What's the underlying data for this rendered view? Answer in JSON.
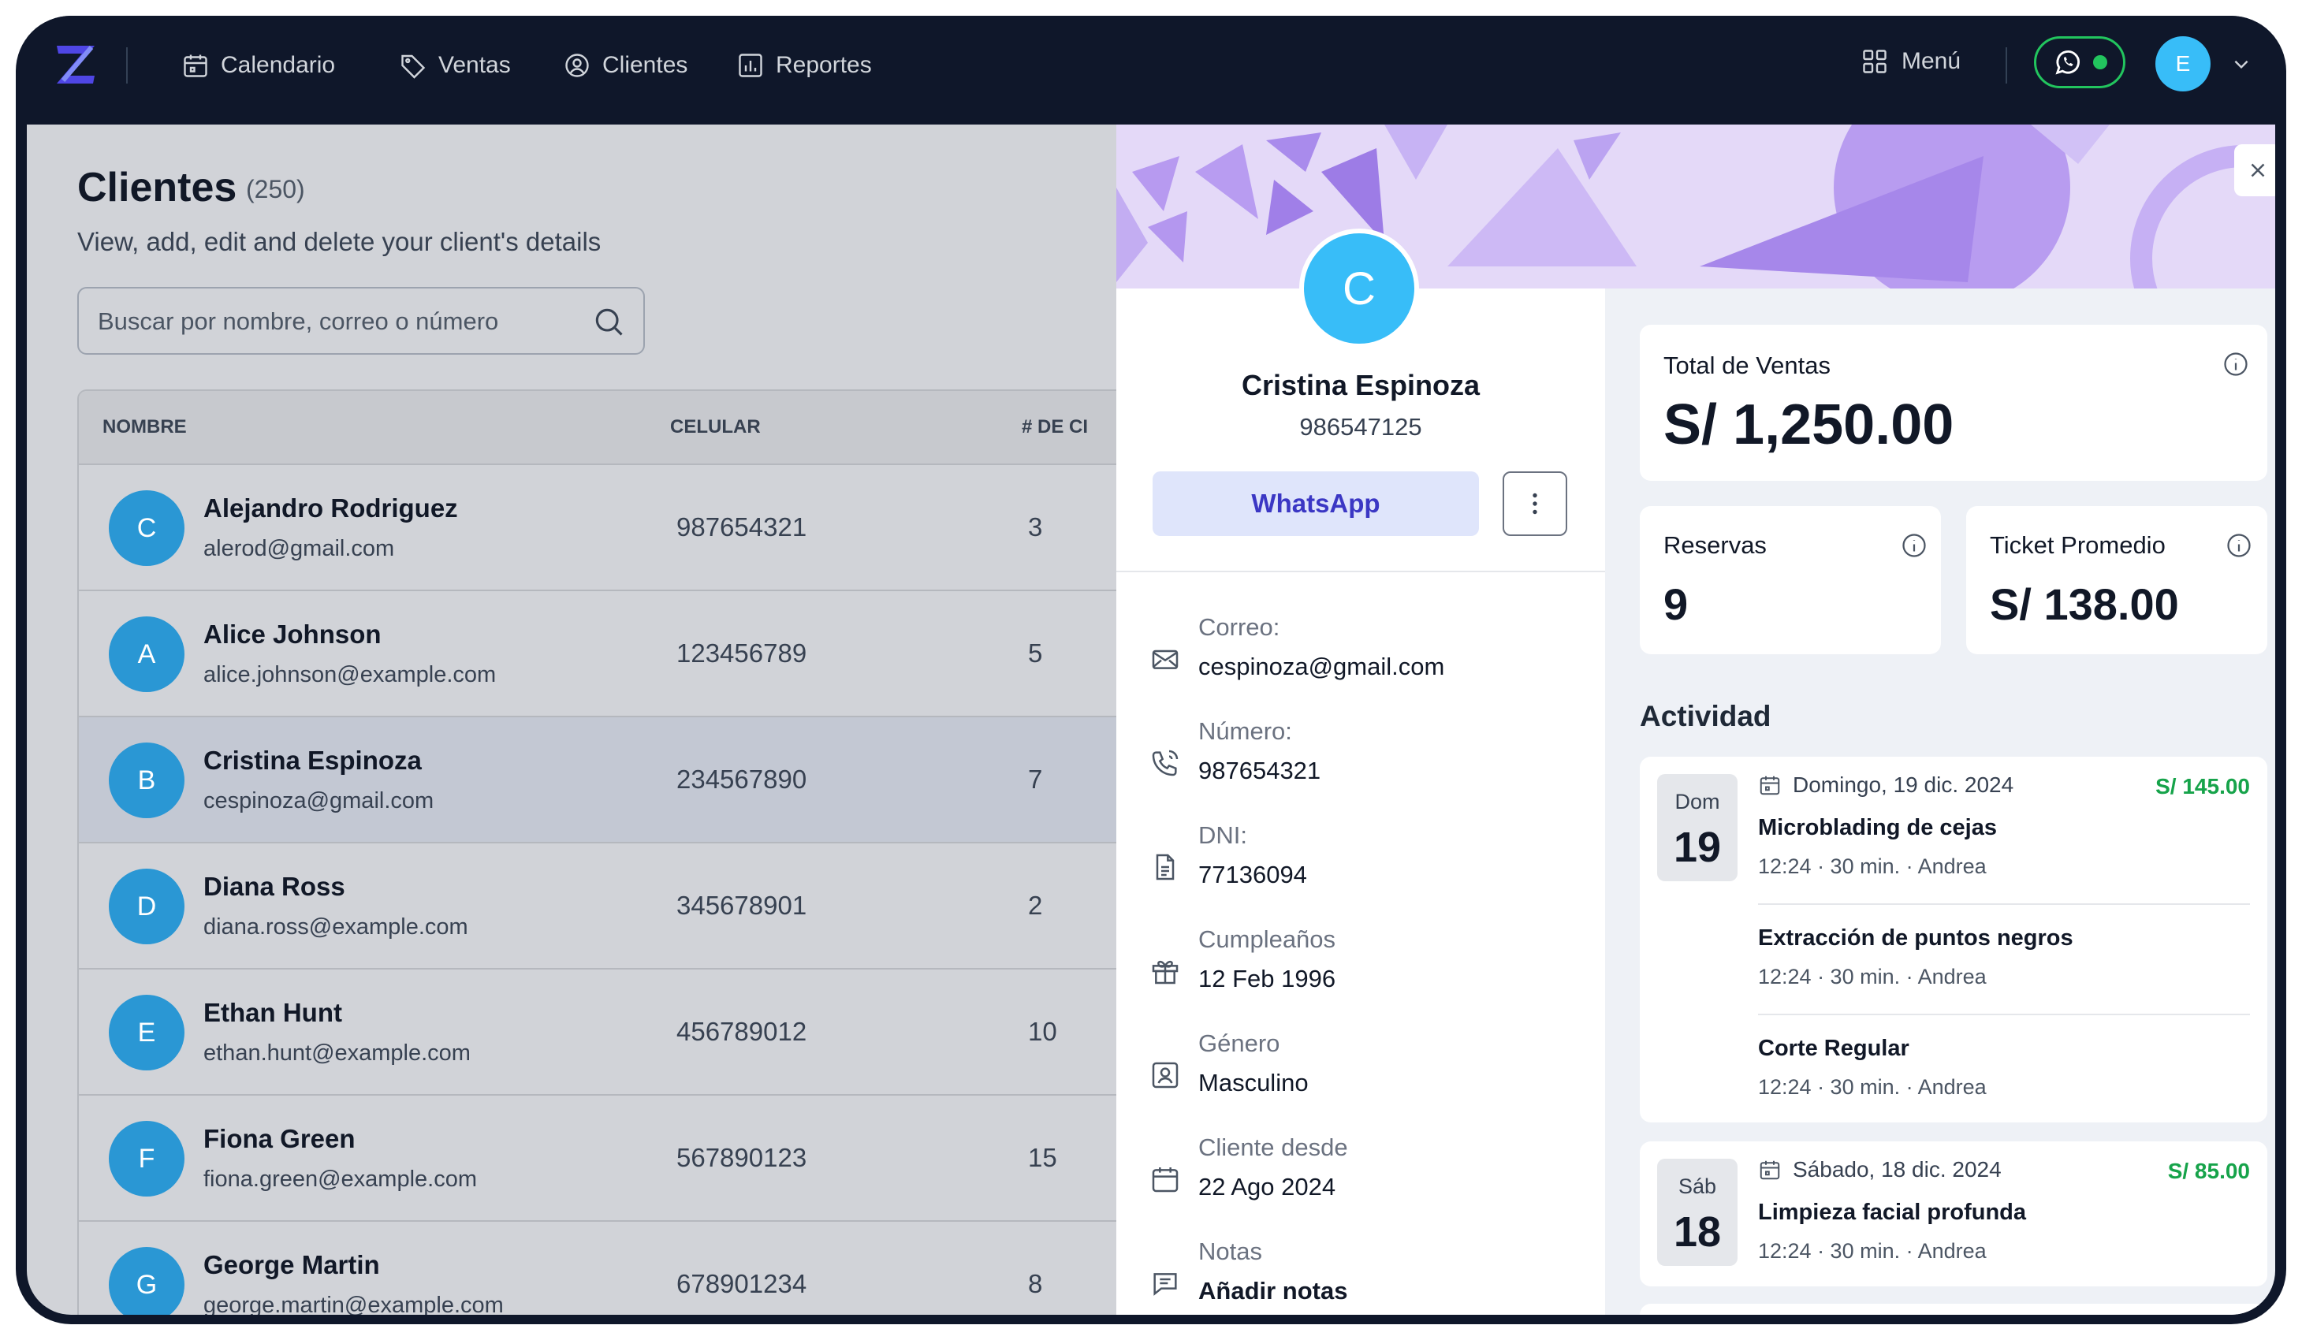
{
  "nav": {
    "items": [
      {
        "label": "Calendario",
        "icon": "calendar-icon"
      },
      {
        "label": "Ventas",
        "icon": "tag-icon"
      },
      {
        "label": "Clientes",
        "icon": "user-circle-icon"
      },
      {
        "label": "Reportes",
        "icon": "bar-chart-icon"
      }
    ],
    "menu_label": "Menú",
    "avatar_initial": "E"
  },
  "clients": {
    "title": "Clientes",
    "count": "(250)",
    "subtitle": "View, add, edit and delete your client's details",
    "search_placeholder": "Buscar por nombre, correo o número",
    "columns": [
      "NOMBRE",
      "CELULAR",
      "# DE CI"
    ],
    "rows": [
      {
        "initial": "C",
        "name": "Alejandro Rodriguez",
        "email": "alerod@gmail.com",
        "phone": "987654321",
        "count": "3"
      },
      {
        "initial": "A",
        "name": "Alice Johnson",
        "email": "alice.johnson@example.com",
        "phone": "123456789",
        "count": "5"
      },
      {
        "initial": "B",
        "name": "Cristina Espinoza",
        "email": "cespinoza@gmail.com",
        "phone": "234567890",
        "count": "7"
      },
      {
        "initial": "D",
        "name": "Diana Ross",
        "email": "diana.ross@example.com",
        "phone": "345678901",
        "count": "2"
      },
      {
        "initial": "E",
        "name": "Ethan Hunt",
        "email": "ethan.hunt@example.com",
        "phone": "456789012",
        "count": "10"
      },
      {
        "initial": "F",
        "name": "Fiona Green",
        "email": "fiona.green@example.com",
        "phone": "567890123",
        "count": "15"
      },
      {
        "initial": "G",
        "name": "George Martin",
        "email": "george.martin@example.com",
        "phone": "678901234",
        "count": "8"
      }
    ]
  },
  "profile": {
    "initial": "C",
    "name": "Cristina Espinoza",
    "phone": "986547125",
    "whatsapp_label": "WhatsApp",
    "fields": [
      {
        "label": "Correo:",
        "value": "cespinoza@gmail.com",
        "icon": "mail-icon"
      },
      {
        "label": "Número:",
        "value": "987654321",
        "icon": "phone-icon"
      },
      {
        "label": "DNI:",
        "value": "77136094",
        "icon": "document-icon"
      },
      {
        "label": "Cumpleaños",
        "value": "12 Feb 1996",
        "icon": "gift-icon"
      },
      {
        "label": "Género",
        "value": "Masculino",
        "icon": "id-card-icon"
      },
      {
        "label": "Cliente desde",
        "value": "22 Ago 2024",
        "icon": "calendar-icon"
      },
      {
        "label": "Notas",
        "value": "Añadir notas",
        "icon": "chat-icon"
      }
    ]
  },
  "stats": {
    "total_label": "Total de Ventas",
    "total_value": "S/ 1,250.00",
    "reservas_label": "Reservas",
    "reservas_value": "9",
    "ticket_label": "Ticket Promedio",
    "ticket_value": "S/ 138.00"
  },
  "activity": {
    "title": "Actividad",
    "groups": [
      {
        "weekday": "Dom",
        "day": "19",
        "date": "Domingo, 19 dic. 2024",
        "price": "S/ 145.00",
        "items": [
          {
            "name": "Microblading de cejas",
            "meta": "12:24  ·  30 min.  ·  Andrea"
          },
          {
            "name": "Extracción de puntos negros",
            "meta": "12:24  ·  30 min.  ·  Andrea"
          },
          {
            "name": "Corte Regular",
            "meta": "12:24  ·  30 min.  ·  Andrea"
          }
        ]
      },
      {
        "weekday": "Sáb",
        "day": "18",
        "date": "Sábado, 18 dic. 2024",
        "price": "S/ 85.00",
        "items": [
          {
            "name": "Limpieza facial profunda",
            "meta": "12:24  ·  30 min.  ·  Andrea"
          }
        ]
      }
    ]
  },
  "colors": {
    "accent": "#3b37c4",
    "avatar": "#38bdf8",
    "price": "#16a34a",
    "whatsapp": "#22c55e"
  }
}
